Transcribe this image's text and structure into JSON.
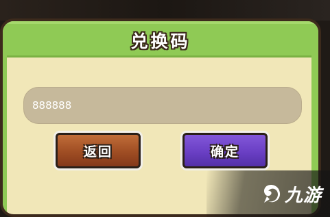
{
  "dialog": {
    "title": "兑换码",
    "input_value": "888888",
    "back_label": "返回",
    "confirm_label": "确定"
  },
  "watermark": {
    "text": "九游",
    "icon": "swirl-logo-icon"
  },
  "colors": {
    "title_bar": "#8fca55",
    "panel": "#f1e7b8",
    "input": "#c6b99b",
    "back_button": "#9f4d23",
    "confirm_button": "#6a3fc4"
  }
}
